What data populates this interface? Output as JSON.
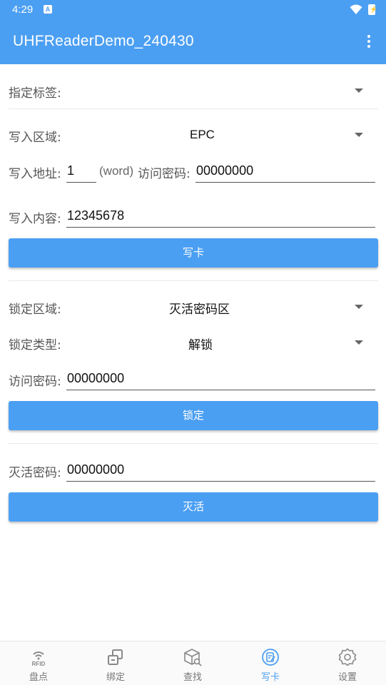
{
  "status_bar": {
    "time": "4:29",
    "notification": "A"
  },
  "app_bar": {
    "title": "UHFReaderDemo_240430"
  },
  "tag_select": {
    "label": "指定标签:",
    "value": ""
  },
  "write": {
    "area_label": "写入区域:",
    "area_value": "EPC",
    "address_label": "写入地址:",
    "address_value": "1",
    "word_unit": "(word)",
    "password_label": "访问密码:",
    "password_value": "00000000",
    "content_label": "写入内容:",
    "content_value": "12345678",
    "button": "写卡"
  },
  "lock": {
    "area_label": "锁定区域:",
    "area_value": "灭活密码区",
    "type_label": "锁定类型:",
    "type_value": "解锁",
    "password_label": "访问密码:",
    "password_value": "00000000",
    "button": "锁定"
  },
  "kill": {
    "password_label": "灭活密码:",
    "password_value": "00000000",
    "button": "灭活"
  },
  "bottom_nav": {
    "items": [
      {
        "label": "盘点",
        "icon": "rfid-icon",
        "badge": "RFID"
      },
      {
        "label": "绑定",
        "icon": "bind-icon"
      },
      {
        "label": "查找",
        "icon": "search-box-icon"
      },
      {
        "label": "写卡",
        "icon": "write-card-icon",
        "active": true
      },
      {
        "label": "设置",
        "icon": "gear-icon"
      }
    ]
  },
  "colors": {
    "primary": "#4b9ff2",
    "background": "#ffffff"
  }
}
